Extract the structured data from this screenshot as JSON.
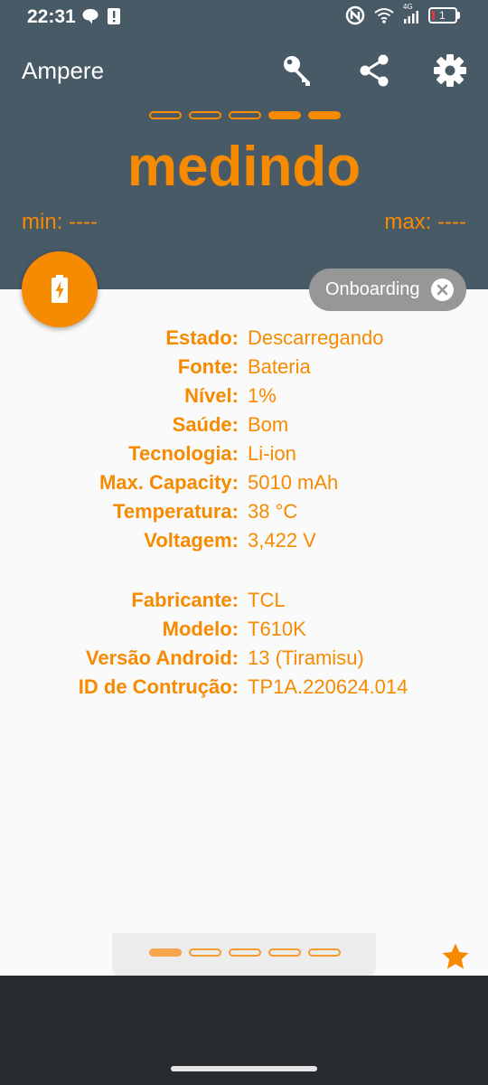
{
  "status_bar": {
    "time": "22:31",
    "network": "4G",
    "battery_level": "1"
  },
  "app": {
    "title": "Ampere",
    "status_word": "medindo",
    "min_label": "min: ----",
    "max_label": "max: ----",
    "onboarding_chip": "Onboarding"
  },
  "top_pager": {
    "count": 5,
    "active": [
      3,
      4
    ]
  },
  "bottom_pager": {
    "count": 5,
    "active": [
      0
    ]
  },
  "battery_info": [
    {
      "label": "Estado:",
      "value": "Descarregando"
    },
    {
      "label": "Fonte:",
      "value": "Bateria"
    },
    {
      "label": "Nível:",
      "value": "1%"
    },
    {
      "label": "Saúde:",
      "value": "Bom"
    },
    {
      "label": "Tecnologia:",
      "value": "Li-ion"
    },
    {
      "label": "Max. Capacity:",
      "value": "5010 mAh"
    },
    {
      "label": "Temperatura:",
      "value": "38 °C"
    },
    {
      "label": "Voltagem:",
      "value": "3,422 V"
    }
  ],
  "device_info": [
    {
      "label": "Fabricante:",
      "value": "TCL"
    },
    {
      "label": "Modelo:",
      "value": "T610K"
    },
    {
      "label": "Versão Android:",
      "value": "13 (Tiramisu)"
    },
    {
      "label": "ID de Contrução:",
      "value": "TP1A.220624.014"
    }
  ],
  "icons": {
    "key": "key-icon",
    "share": "share-icon",
    "settings": "gear-icon",
    "battery_fab": "battery-charging-icon",
    "star": "star-icon"
  },
  "colors": {
    "accent": "#f68a00",
    "header": "#485a66",
    "chip": "#979797",
    "navbar": "#272b2f"
  }
}
